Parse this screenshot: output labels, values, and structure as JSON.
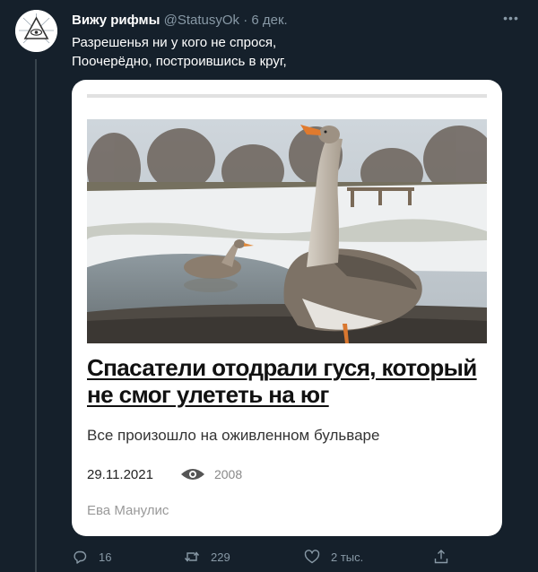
{
  "tweet": {
    "author_name": "Вижу рифмы",
    "handle": "@StatusyOk",
    "separator": "·",
    "date": "6 дек.",
    "lines": [
      "Разрешенья ни у кого не спрося,",
      "Поочерёдно, построившись в круг,"
    ]
  },
  "card": {
    "headline_lines": [
      "Спасатели отодрали гуся, который",
      "не смог улететь на юг"
    ],
    "subtitle": "Все произошло на оживленном бульваре",
    "date": "29.11.2021",
    "views": "2008",
    "author": "Ева Манулис"
  },
  "actions": {
    "replies": "16",
    "retweets": "229",
    "likes": "2 тыс."
  },
  "icons": {
    "more": "more-icon",
    "reply": "reply-icon",
    "retweet": "retweet-icon",
    "like": "heart-icon",
    "share": "share-icon",
    "views": "eye-icon"
  },
  "colors": {
    "background": "#15202b",
    "secondary_text": "#8899a6",
    "card_background": "#ffffff"
  }
}
